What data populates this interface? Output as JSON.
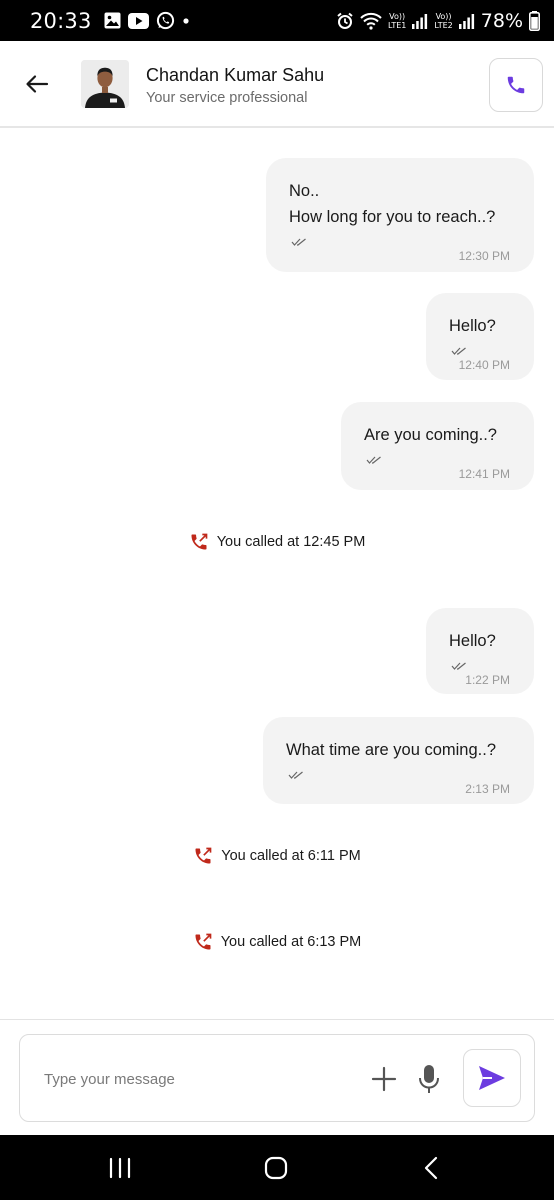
{
  "status_bar": {
    "time": "20:33",
    "left_icons": [
      "gallery-icon",
      "youtube-icon",
      "whatsapp-icon",
      "dot-icon"
    ],
    "sim1_label_top": "Vo))",
    "sim1_label_bottom": "LTE1",
    "sim2_label_top": "Vo))",
    "sim2_label_bottom": "LTE2",
    "battery": "78%"
  },
  "header": {
    "contact_name": "Chandan Kumar Sahu",
    "contact_subtitle": "Your service professional",
    "accent_color": "#6c3ce0"
  },
  "messages": [
    {
      "lines": [
        "No..",
        "How long for you to reach..?"
      ],
      "time": "12:30 PM"
    },
    {
      "lines": [
        "Hello?"
      ],
      "time": "12:40 PM"
    },
    {
      "lines": [
        "Are you coming..?"
      ],
      "time": "12:41 PM"
    },
    {
      "lines": [
        "Hello?"
      ],
      "time": "1:22 PM"
    },
    {
      "lines": [
        "What time are you coming..?"
      ],
      "time": "2:13 PM"
    }
  ],
  "call_events": [
    {
      "text": "You called at 12:45 PM"
    },
    {
      "text": "You called at 6:11 PM"
    },
    {
      "text": "You called at 6:13 PM"
    }
  ],
  "composer": {
    "placeholder": "Type your message"
  },
  "colors": {
    "bubble_bg": "#f3f3f3",
    "missed_call_red": "#c0291b",
    "send_purple": "#6c3ce0"
  }
}
